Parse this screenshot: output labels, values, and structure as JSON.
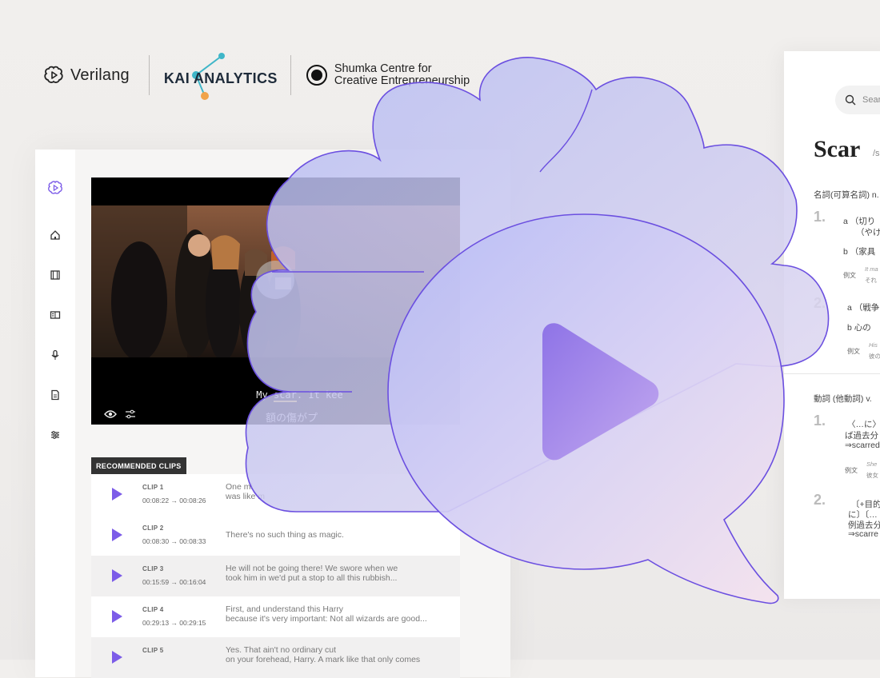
{
  "logos": {
    "verilang": "Verilang",
    "kai": "KAI ANALYTICS",
    "shumka_line1": "Shumka Centre for",
    "shumka_line2": "Creative Entrepreneurship"
  },
  "sidebar": {
    "items": [
      "brain-logo-icon",
      "home-icon",
      "film-icon",
      "book-icon",
      "microphone-icon",
      "document-icon",
      "sliders-icon"
    ]
  },
  "video": {
    "subtitle_en_pre": "My ",
    "subtitle_en_word": "scar",
    "subtitle_en_post": ". It kee",
    "subtitle_jp": "額の傷がプ"
  },
  "recommended": {
    "label": "RECOMMENDED CLIPS",
    "clips": [
      {
        "num": "CLIP 1",
        "time": "00:08:22 → 00:08:26",
        "line1": "One mi",
        "line2": "was like m"
      },
      {
        "num": "CLIP 2",
        "time": "00:08:30 → 00:08:33",
        "line1": "There's no such thing as magic.",
        "line2": ""
      },
      {
        "num": "CLIP 3",
        "time": "00:15:59 → 00:16:04",
        "line1": "He will not be going there! We swore when we",
        "line2": "took him in we'd put a stop to all this rubbish..."
      },
      {
        "num": "CLIP 4",
        "time": "00:29:13 → 00:29:15",
        "line1": "First, and understand this Harry",
        "line2": "because it's very important: Not all wizards are good..."
      },
      {
        "num": "CLIP 5",
        "time": "",
        "line1": "Yes. That ain't no ordinary cut",
        "line2": "on your forehead, Harry. A mark like that only comes"
      }
    ]
  },
  "dictionary": {
    "search_placeholder": "Sear",
    "word": "Scar",
    "ipa": "/s",
    "noun_pos": "名詞(可算名詞) n.",
    "sense1_num": "1.",
    "s1a": "a （切り",
    "s1a2": "（やけ",
    "s1b": "b （家具",
    "ex_label1": "例文",
    "ex1_en": "It ma",
    "ex1_jp": "それ",
    "sense2_num": "2.",
    "s2a": "a （戦争",
    "s2b": "b 心の",
    "ex_label2": "例文",
    "ex2_en": "His",
    "ex2_jp": "彼の",
    "verb_pos": "動詞 (他動詞) v.",
    "v1_num": "1.",
    "v1_l1": "〈…に〉",
    "v1_l2": "ば過去分",
    "v1_l3": "⇒scarred",
    "ex_label3": "例文",
    "ex3_en": "She",
    "ex3_jp": "彼女",
    "v2_num": "2.",
    "v2_l1": "〔+目的",
    "v2_l2": "に〕〔…",
    "v2_l3": "例過去分",
    "v2_l4": "⇒scarre"
  },
  "colors": {
    "accent": "#7c5ce8",
    "overlay_stroke": "#6b4fe0",
    "dark_label": "#333333"
  }
}
